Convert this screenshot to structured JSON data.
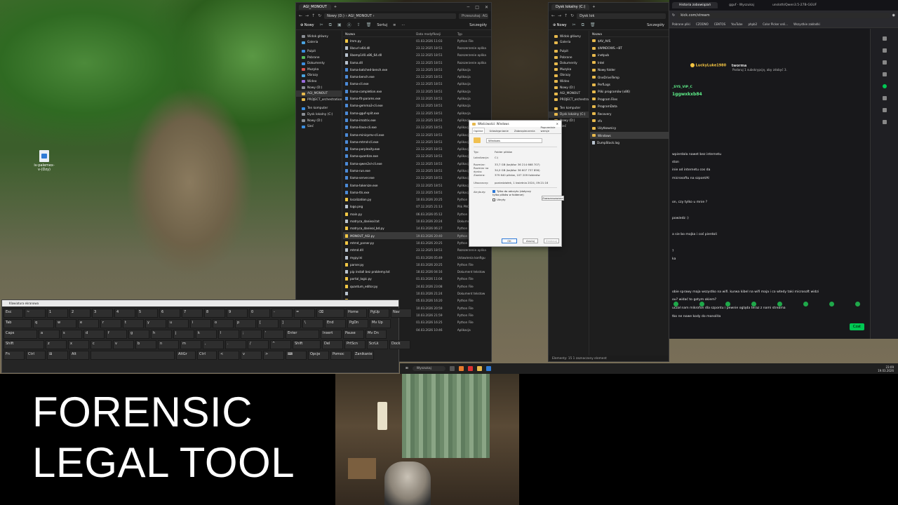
{
  "desktop": {
    "icon_label": "iv-palemex-v-(Dzy)"
  },
  "explorer_main": {
    "tab_title": "AGI_MONOUT",
    "address": "Nowy (D:)  ›  AGI_MONOUT  ›",
    "search_placeholder": "Przeszukaj: AG",
    "new_label": "Nowy",
    "sort_label": "Sortuj",
    "view_label": "Wyświetl",
    "details_label": "Szczegóły",
    "sidebar": [
      {
        "label": "Widok główny",
        "icon": "home"
      },
      {
        "label": "Galeria",
        "icon": "gallery"
      },
      {
        "label": "",
        "icon": ""
      },
      {
        "label": "Pulpit",
        "icon": "desktop"
      },
      {
        "label": "Pobrane",
        "icon": "downloads"
      },
      {
        "label": "Dokumenty",
        "icon": "documents"
      },
      {
        "label": "Muzyka",
        "icon": "music"
      },
      {
        "label": "Obrazy",
        "icon": "pictures"
      },
      {
        "label": "Wideo",
        "icon": "video"
      },
      {
        "label": "Nowy (D:)",
        "icon": "drive"
      },
      {
        "label": "AGI_MONOUT",
        "icon": "folder"
      },
      {
        "label": "PROJECT_orchestration",
        "icon": "folder"
      },
      {
        "label": "",
        "icon": ""
      },
      {
        "label": "Ten komputer",
        "icon": "pc"
      },
      {
        "label": "Dysk lokalny (C:)",
        "icon": "drive"
      },
      {
        "label": "Nowy (D:)",
        "icon": "drive"
      },
      {
        "label": "Sieć",
        "icon": "network"
      }
    ],
    "columns": {
      "name": "Nazwa",
      "date": "Data modyfikacji",
      "type": "Typ"
    },
    "files": [
      {
        "name": "lmm.py",
        "date": "01.03.2026 11:03",
        "type": "Python File",
        "kind": "py"
      },
      {
        "name": "libcurl-x64.dll",
        "date": "23.12.2025 18:51",
        "type": "Rozszerzenie aplika",
        "kind": "dll"
      },
      {
        "name": "libomp140.x86_64.dll",
        "date": "23.12.2025 18:51",
        "type": "Rozszerzenie aplika",
        "kind": "dll"
      },
      {
        "name": "llama.dll",
        "date": "23.12.2025 18:51",
        "type": "Rozszerzenie aplika",
        "kind": "dll"
      },
      {
        "name": "llama-batched-bench.exe",
        "date": "23.12.2025 18:51",
        "type": "Aplikacja",
        "kind": "exe"
      },
      {
        "name": "llama-bench.exe",
        "date": "23.12.2025 18:51",
        "type": "Aplikacja",
        "kind": "exe"
      },
      {
        "name": "llama-cli.exe",
        "date": "23.12.2025 18:51",
        "type": "Aplikacja",
        "kind": "exe"
      },
      {
        "name": "llama-completion.exe",
        "date": "23.12.2025 18:51",
        "type": "Aplikacja",
        "kind": "exe"
      },
      {
        "name": "llama-fit-params.exe",
        "date": "23.12.2025 18:51",
        "type": "Aplikacja",
        "kind": "exe"
      },
      {
        "name": "llama-gemma3-cli.exe",
        "date": "23.12.2025 18:51",
        "type": "Aplikacja",
        "kind": "exe"
      },
      {
        "name": "llama-gguf-split.exe",
        "date": "23.12.2025 18:51",
        "type": "Aplikacja",
        "kind": "exe"
      },
      {
        "name": "llama-imatrix.exe",
        "date": "23.12.2025 18:51",
        "type": "Aplikacja",
        "kind": "exe"
      },
      {
        "name": "llama-llava-cli.exe",
        "date": "23.12.2025 18:51",
        "type": "Aplikacja",
        "kind": "exe"
      },
      {
        "name": "llama-minicpmv-cli.exe",
        "date": "23.12.2025 18:51",
        "type": "Aplikacja",
        "kind": "exe"
      },
      {
        "name": "llama-mtmd-cli.exe",
        "date": "23.12.2025 18:51",
        "type": "Aplikacja",
        "kind": "exe"
      },
      {
        "name": "llama-perplexity.exe",
        "date": "23.12.2025 18:51",
        "type": "Aplikacja",
        "kind": "exe"
      },
      {
        "name": "llama-quantize.exe",
        "date": "23.12.2025 18:51",
        "type": "Aplikacja",
        "kind": "exe"
      },
      {
        "name": "llama-qwen2vl-cli.exe",
        "date": "23.12.2025 18:51",
        "type": "Aplikacja",
        "kind": "exe"
      },
      {
        "name": "llama-run.exe",
        "date": "23.12.2025 18:51",
        "type": "Aplikacja",
        "kind": "exe"
      },
      {
        "name": "llama-server.exe",
        "date": "23.12.2025 18:51",
        "type": "Aplikacja",
        "kind": "exe"
      },
      {
        "name": "llama-tokenize.exe",
        "date": "23.12.2025 18:51",
        "type": "Aplikacja",
        "kind": "exe"
      },
      {
        "name": "llama-tts.exe",
        "date": "23.12.2025 18:51",
        "type": "Aplikacja",
        "kind": "exe"
      },
      {
        "name": "localization.py",
        "date": "10.03.2026 20:25",
        "type": "Python File",
        "kind": "py"
      },
      {
        "name": "logo.png",
        "date": "07.12.2025 21:13",
        "type": "Plik PNG",
        "kind": "img"
      },
      {
        "name": "main.py",
        "date": "06.03.2026 05:12",
        "type": "Python File",
        "kind": "py"
      },
      {
        "name": "matryca_danieal.txt",
        "date": "10.03.2026 20:24",
        "type": "Dokument tekstow",
        "kind": "txt"
      },
      {
        "name": "matryca_danieal_bd.py",
        "date": "14.03.2026 06:27",
        "type": "Python File",
        "kind": "py"
      },
      {
        "name": "MONOUT_AGI.py",
        "date": "19.03.2026 20:40",
        "type": "Python File",
        "kind": "py"
      },
      {
        "name": "mtmd_parser.py",
        "date": "10.03.2026 20:25",
        "type": "Python File",
        "kind": "py"
      },
      {
        "name": "mtmd.dll",
        "date": "23.12.2025 18:51",
        "type": "Rozszerzenie aplika",
        "kind": "dll"
      },
      {
        "name": "mypy.ini",
        "date": "01.03.2026 05:49",
        "type": "Ustawienia konfigu",
        "kind": "txt"
      },
      {
        "name": "parser.py",
        "date": "10.03.2026 20:25",
        "type": "Python File",
        "kind": "py"
      },
      {
        "name": "pip install bez problemy.txt",
        "date": "18.02.2026 04:16",
        "type": "Dokument tekstow",
        "kind": "txt"
      },
      {
        "name": "portal_logic.py",
        "date": "01.03.2026 11:04",
        "type": "Python File",
        "kind": "py"
      },
      {
        "name": "quantum_editor.py",
        "date": "24.02.2026 23:08",
        "type": "Python File",
        "kind": "py"
      },
      {
        "name": "",
        "date": "10.03.2026 21:24",
        "type": "Dokument tekstow",
        "kind": "txt"
      },
      {
        "name": "",
        "date": "05.03.2026 16:20",
        "type": "Python File",
        "kind": "py"
      },
      {
        "name": "",
        "date": "10.03.2026 20:59",
        "type": "Python File",
        "kind": "py"
      },
      {
        "name": "",
        "date": "10.03.2026 21:59",
        "type": "Python File",
        "kind": "py"
      },
      {
        "name": "",
        "date": "01.03.2026 16:25",
        "type": "Python File",
        "kind": "py"
      },
      {
        "name": "",
        "date": "04.03.2026 10:46",
        "type": "Aplikacja",
        "kind": "exe"
      }
    ]
  },
  "explorer_c": {
    "tab_title": "Dysk lokalny (C:)",
    "address": "Dysk lok",
    "new_label": "Nowy",
    "details_label": "Szczegóły",
    "sidebar": [
      "Widok główny",
      "Galeria",
      "",
      "Pulpit",
      "Pobrane",
      "Dokumenty",
      "Muzyka",
      "Obrazy",
      "Wideo",
      "Nowy (D:)",
      "AGI_MONOUT",
      "PROJECT_orchestra",
      "",
      "Ten komputer",
      "Dysk lokalny (C:)",
      "Nowy (D:)",
      "Sieć"
    ],
    "column_name": "Nazwa",
    "items": [
      "$AV_AVS",
      "$WINDOWS.~BT",
      "inetpub",
      "Intel",
      "Nowy folder",
      "OneDriveTemp",
      "PerfLogs",
      "Pliki programów (x86)",
      "Program Files",
      "ProgramData",
      "Recovery",
      "sfx",
      "Użytkownicy",
      "Windows",
      "DumpStack.log"
    ],
    "status": "Elementy: 15    1 zaznaczony element"
  },
  "properties": {
    "title": "Właściwości: Windows",
    "tabs": [
      "Ogólne",
      "Udostępnianie",
      "Zabezpieczenia",
      "Poprzednie wersje"
    ],
    "name": "Windows",
    "rows": [
      {
        "label": "Typ:",
        "value": "Folder plików"
      },
      {
        "label": "Lokalizacja:",
        "value": "C:\\"
      },
      {
        "label": "Rozmiar:",
        "value": "33,7 GB (bajtów: 36 214 668 707)"
      },
      {
        "label": "Rozmiar na dysku:",
        "value": "34,0 GB (bajtów: 36 607 737 856)"
      },
      {
        "label": "Zawiera:",
        "value": "379 640 plików, 107 209 folderów"
      },
      {
        "label": "Utworzony:",
        "value": "poniedziałek, 1 kwietnia 2024, 09:21:16"
      }
    ],
    "attributes_label": "Atrybuty:",
    "readonly_label": "Tylko do odczytu (dotyczy tylko plików w folderze)",
    "hidden_label": "Ukryty",
    "advanced_label": "Zaawansowane...",
    "ok": "OK",
    "cancel": "Anuluj",
    "apply": "Zastosuj"
  },
  "browser": {
    "tabs": [
      "Historia zobowiązań",
      "gguf - Wyszukaj",
      "unsloth/Qwen3.5-27B-GGUF"
    ],
    "url": "kick.com/stream",
    "bookmarks": [
      "Pobrane pliki",
      "CZODNO",
      "CENTOS",
      "YouTube",
      "phpb2",
      "Color Picker onli...",
      "Wszystkie zakładki"
    ],
    "chat_user": "LuckyLuke1980",
    "chat_user2": "tworma",
    "sub_hint": "Podaruj 1 subskrypcję, aby zdobyć 3.",
    "channel_line1": "_SYS_VIP_C",
    "channel_line2": "1ggwxkxb84",
    "messages": [
      "wpierdala nawet bez internetu",
      "ston",
      "inie od internetu cos da",
      "microsoftu na szpontAI",
      "on, czy tylko u mnie ?",
      "powiedz :)",
      "a sie bo mojka i coś pierdoli",
      "?",
      "ka",
      "obie sprawy maja wszystko na wifi. kurwa kibel na wifi maja i co wtedy taki microsoft widzi",
      "ou? widać to gotym okiem?",
      "uczał nam mikrofon dla szpontu i pewnie ogląda teraz z nami streama",
      "tko ne nowe kody do monolita"
    ],
    "chat_button": "Czat"
  },
  "keyboard": {
    "title": "Klawiatura ekranowa",
    "row1": [
      "Esc",
      "~",
      "1",
      "2",
      "3",
      "4",
      "5",
      "6",
      "7",
      "8",
      "9",
      "0",
      "-",
      "=",
      "⌫",
      "Home",
      "PgUp",
      "Nav"
    ],
    "row2": [
      "Tab",
      "q",
      "w",
      "e",
      "r",
      "t",
      "y",
      "u",
      "i",
      "o",
      "p",
      "[",
      "]",
      "\\",
      "End",
      "PgDn",
      "Mv Up"
    ],
    "row3": [
      "Caps",
      "a",
      "s",
      "d",
      "f",
      "g",
      "h",
      "j",
      "k",
      "l",
      ";",
      "'",
      "Enter",
      "Insert",
      "Pause",
      "Mv Dn"
    ],
    "row4": [
      "Shift",
      "z",
      "x",
      "c",
      "v",
      "b",
      "n",
      "m",
      ",",
      ".",
      "/",
      "^",
      "Shift",
      "Del",
      "PrtScn",
      "ScrLk",
      "Dock"
    ],
    "row5": [
      "Fn",
      "Ctrl",
      "⊞",
      "Alt",
      "",
      "AltGr",
      "Ctrl",
      "<",
      "v",
      ">",
      "⌨",
      "Opcje",
      "Pomoc",
      "Zanikanie"
    ]
  },
  "taskbar": {
    "search_placeholder": "Wyszukaj",
    "time": "23:09",
    "date": "19.03.2026"
  },
  "caption": {
    "line1": "FORENSIC",
    "line2": "LEGAL TOOL"
  }
}
